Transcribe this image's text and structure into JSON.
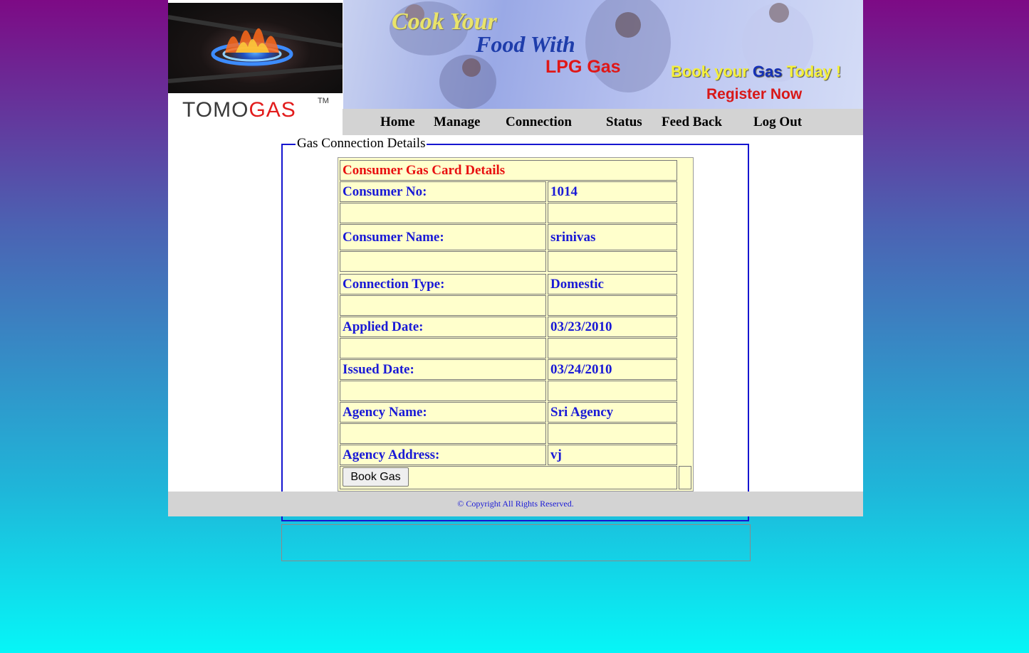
{
  "logo": {
    "brand_part1": "TOMO",
    "brand_part2": "GAS",
    "trademark": "TM"
  },
  "banner": {
    "line1": "Cook Your",
    "line2": "Food With",
    "line3": "LPG Gas",
    "book_prefix": "Book your ",
    "book_gas": "Gas",
    "book_suffix": " Today !",
    "register": "Register Now"
  },
  "nav": {
    "home": "Home",
    "manage": "Manage",
    "connection": "Connection",
    "status": "Status",
    "feedback": "Feed Back",
    "logout": "Log Out"
  },
  "fieldset": {
    "legend": "Gas Connection Details"
  },
  "card": {
    "title": "Consumer Gas Card Details",
    "rows": [
      {
        "label": "Consumer No:",
        "value": "1014"
      },
      {
        "label": "Consumer Name:",
        "value": "srinivas"
      },
      {
        "label": "Connection Type:",
        "value": "Domestic"
      },
      {
        "label": "Applied Date:",
        "value": "03/23/2010"
      },
      {
        "label": "Issued Date:",
        "value": "03/24/2010"
      },
      {
        "label": "Agency Name:",
        "value": "Sri Agency"
      },
      {
        "label": "Agency Address:",
        "value": "vj"
      }
    ],
    "book_button": "Book Gas"
  },
  "footer": {
    "copyright": "© Copyright All Rights Reserved."
  },
  "colors": {
    "label_blue": "#1a1ad6",
    "title_red": "#e81010",
    "cell_bg": "#ffffcc",
    "nav_bg": "#d3d3d3"
  }
}
